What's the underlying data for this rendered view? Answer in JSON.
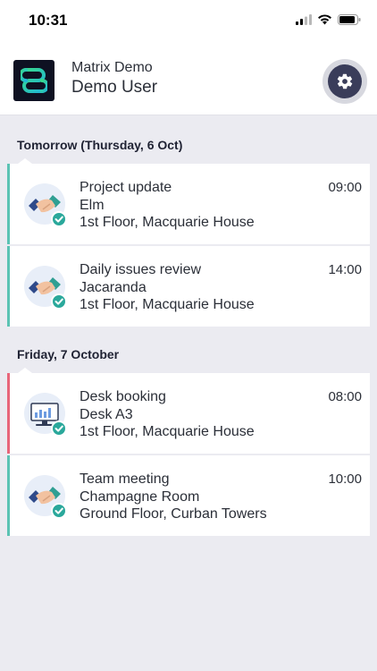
{
  "status_bar": {
    "time": "10:31"
  },
  "header": {
    "app_name": "Matrix Demo",
    "user_name": "Demo User"
  },
  "colors": {
    "accent_teal": "#5cc3b4",
    "accent_red": "#e8667a",
    "settings_bg": "#3a3d5a"
  },
  "days": [
    {
      "label": "Tomorrow (Thursday, 6 Oct)",
      "bookings": [
        {
          "title": "Project update",
          "room": "Elm",
          "location": "1st Floor, Macquarie House",
          "time": "09:00",
          "icon": "handshake-icon"
        },
        {
          "title": "Daily issues review",
          "room": "Jacaranda",
          "location": "1st Floor, Macquarie House",
          "time": "14:00",
          "icon": "handshake-icon"
        }
      ]
    },
    {
      "label": "Friday, 7 October",
      "bookings": [
        {
          "title": "Desk booking",
          "room": "Desk A3",
          "location": "1st Floor, Macquarie House",
          "time": "08:00",
          "icon": "desk-icon"
        },
        {
          "title": "Team meeting",
          "room": "Champagne Room",
          "location": "Ground Floor, Curban Towers",
          "time": "10:00",
          "icon": "handshake-icon"
        }
      ]
    }
  ]
}
